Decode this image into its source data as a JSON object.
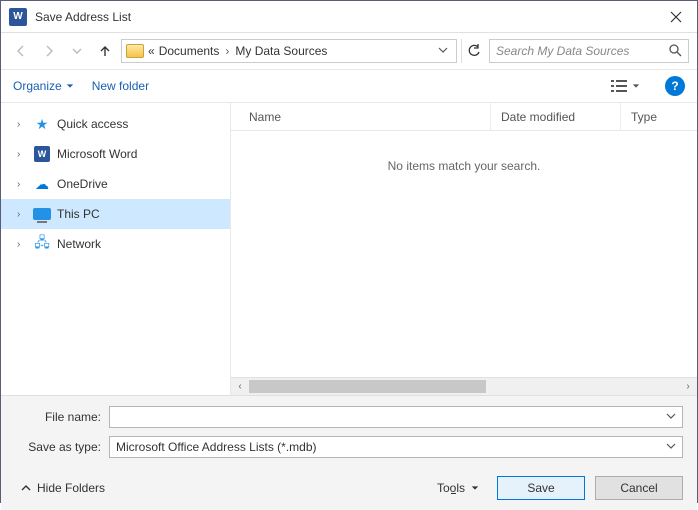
{
  "window": {
    "title": "Save Address List"
  },
  "nav": {
    "breadcrumb_prefix": "«",
    "breadcrumb_seg1": "Documents",
    "breadcrumb_seg2": "My Data Sources",
    "search_placeholder": "Search My Data Sources"
  },
  "toolbar": {
    "organize_label": "Organize",
    "new_folder_label": "New folder"
  },
  "columns": {
    "name": "Name",
    "date": "Date modified",
    "type": "Type"
  },
  "list": {
    "empty_message": "No items match your search."
  },
  "sidebar": {
    "items": [
      {
        "label": "Quick access"
      },
      {
        "label": "Microsoft Word"
      },
      {
        "label": "OneDrive"
      },
      {
        "label": "This PC"
      },
      {
        "label": "Network"
      }
    ]
  },
  "form": {
    "file_name_label": "File name:",
    "file_name_value": "",
    "save_type_label": "Save as type:",
    "save_type_value": "Microsoft Office Address Lists (*.mdb)"
  },
  "footer": {
    "hide_folders_label": "Hide Folders",
    "tools_label": "Tools",
    "save_label": "Save",
    "cancel_label": "Cancel"
  }
}
